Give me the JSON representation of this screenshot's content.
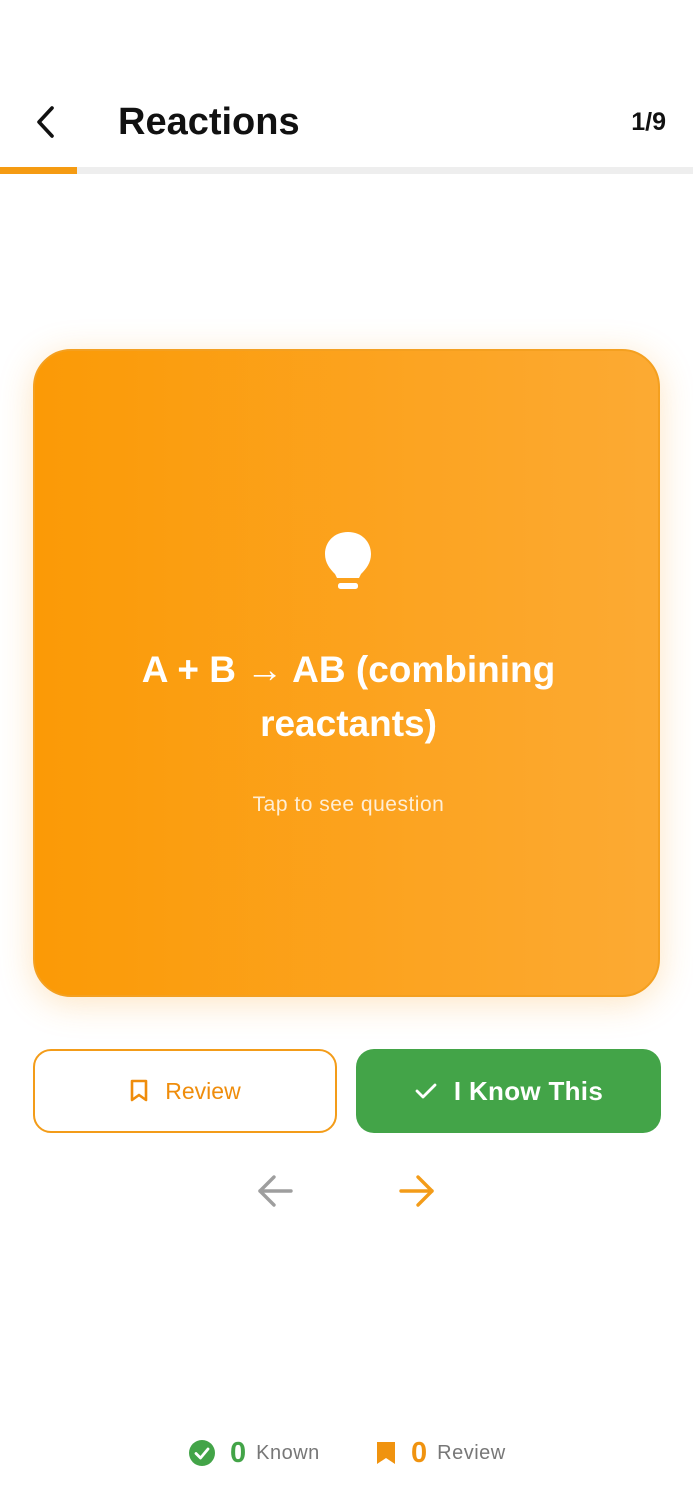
{
  "header": {
    "title": "Reactions",
    "counter": "1/9",
    "back_icon": "chevron-left-icon"
  },
  "progress": {
    "current": 1,
    "total": 9,
    "fraction": 0.111
  },
  "card": {
    "icon": "lightbulb-icon",
    "answer": "A + B → AB (combining reactants)",
    "hint": "Tap to see question"
  },
  "actions": {
    "review_label": "Review",
    "review_icon": "bookmark-outline-icon",
    "know_label": "I Know This",
    "know_icon": "check-icon"
  },
  "navigation": {
    "prev_icon": "arrow-left-icon",
    "next_icon": "arrow-right-icon"
  },
  "stats": {
    "known_count": "0",
    "known_label": "Known",
    "review_count": "0",
    "review_label": "Review"
  },
  "colors": {
    "accent": "#f59b12",
    "success": "#43a448",
    "muted": "#9e9e9e"
  }
}
